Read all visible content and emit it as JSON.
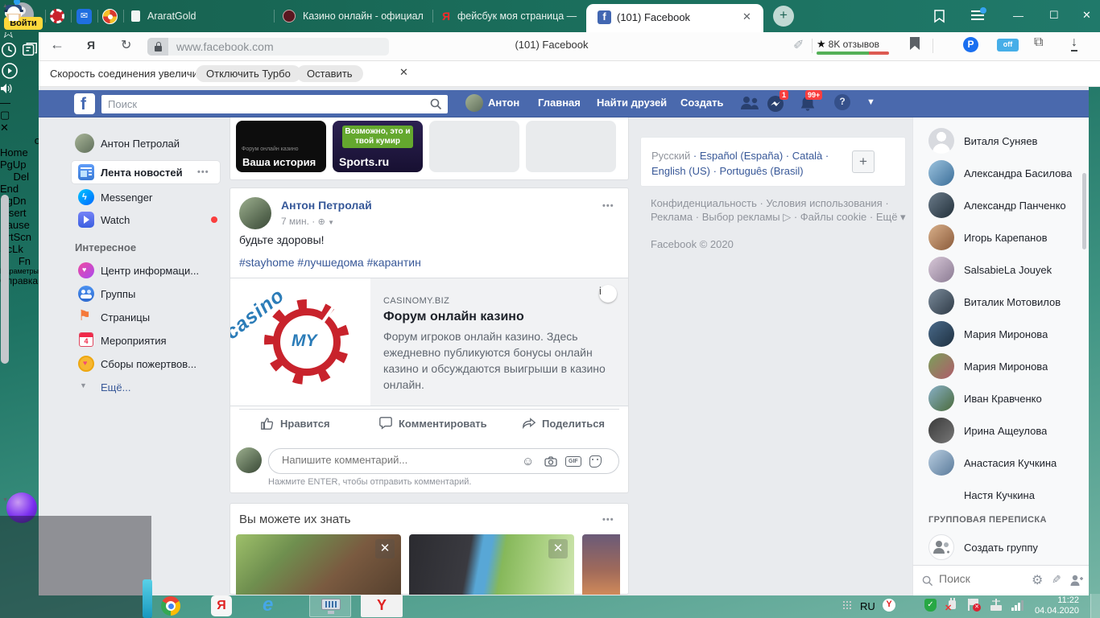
{
  "icons": {
    "yandex_letter": "Я",
    "facebook_letter": "f",
    "ie_letter": "e",
    "ybrowser_letter": "Y",
    "pocket_letter": "P",
    "off_badge": "off",
    "help_glyph": "?",
    "info_glyph": "i",
    "calendar_day": "4",
    "casino_word": "casino",
    "my_word": "MY"
  },
  "browser": {
    "login_badge": "Войти",
    "tab_ararat": "AraratGold",
    "tab_casino": "Казино онлайн - официал",
    "tab_yandex_search": "фейсбук моя страница —",
    "tab_active": "(101) Facebook",
    "url": "www.facebook.com",
    "window_title": "(101) Facebook",
    "reviews": "8K отзывов",
    "turbo_message": "Скорость соединения увеличилась.",
    "turbo_disable": "Отключить Турбо",
    "turbo_keep": "Оставить"
  },
  "facebook": {
    "search_placeholder": "Поиск",
    "profile_short": "Антон",
    "nav_home": "Главная",
    "nav_find_friends": "Найти друзей",
    "nav_create": "Создать",
    "messenger_badge": "1",
    "notif_badge": "99+",
    "left_nav": {
      "profile": "Антон Петролай",
      "feed": "Лента новостей",
      "messenger": "Messenger",
      "watch": "Watch",
      "section": "Интересное",
      "item1": "Центр информаци...",
      "item2": "Группы",
      "item3": "Страницы",
      "item4": "Мероприятия",
      "item5": "Сборы пожертвов...",
      "more": "Ещё..."
    },
    "stories": {
      "your_story_sub": "Форум онлайн казино",
      "your_story": "Ваша история",
      "sports_badge": "Возможно, это и твой кумир",
      "sports": "Sports.ru"
    },
    "post": {
      "author": "Антон Петролай",
      "time": "7 мин. ·",
      "text": "будьте здоровы!",
      "hashtags": "#stayhome #лучшедома #карантин",
      "link_domain": "CASINOMY.BIZ",
      "link_title": "Форум онлайн казино",
      "link_description": "Форум игроков онлайн казино. Здесь ежедневно публикуются бонусы онлайн казино и обсуждаются выигрыши в казино онлайн.",
      "like": "Нравится",
      "comment": "Комментировать",
      "share": "Поделиться",
      "comment_placeholder": "Напишите комментарий...",
      "comment_hint": "Нажмите ENTER, чтобы отправить комментарий.",
      "gif_label": "GIF"
    },
    "suggestions_title": "Вы можете их знать",
    "right_col": {
      "lang_current": "Русский",
      "lang_links": "· Español (España) · Català · English (US) · Português (Brasil)",
      "footer_links": "Конфиденциальность · Условия использования · Реклама · Выбор рекламы ▷ · Файлы cookie · Ещё ▾",
      "copyright": "Facebook © 2020"
    },
    "contacts": {
      "names": [
        "Виталя Суняев",
        "Александра Басилова",
        "Александр Панченко",
        "Игорь Карепанов",
        "SalsabieLa Jouyek",
        "Виталик Мотовилов",
        "Мария Миронова",
        "Мария Миронова",
        "Иван Кравченко",
        "Ирина Ащеулова",
        "Анастасия Кучкина",
        "Настя Кучкина"
      ],
      "group_header": "ГРУППОВАЯ ПЕРЕПИСКА",
      "create_group": "Создать группу",
      "search_placeholder": "Поиск"
    }
  },
  "keyboard": {
    "r1l": "o",
    "r1m": "Home",
    "r1r": "PgUp",
    "r2l": "Del",
    "r2m": "End",
    "r2r": "PgDn",
    "r3m": "Insert",
    "r3r": "Pause",
    "r4m": "PrtScn",
    "r4r": "ScLk",
    "r5l": "Fn",
    "r5m": "Параметры",
    "r5r": "Справка"
  },
  "taskbar": {
    "lang": "RU",
    "time": "11:22",
    "date": "04.04.2020"
  }
}
